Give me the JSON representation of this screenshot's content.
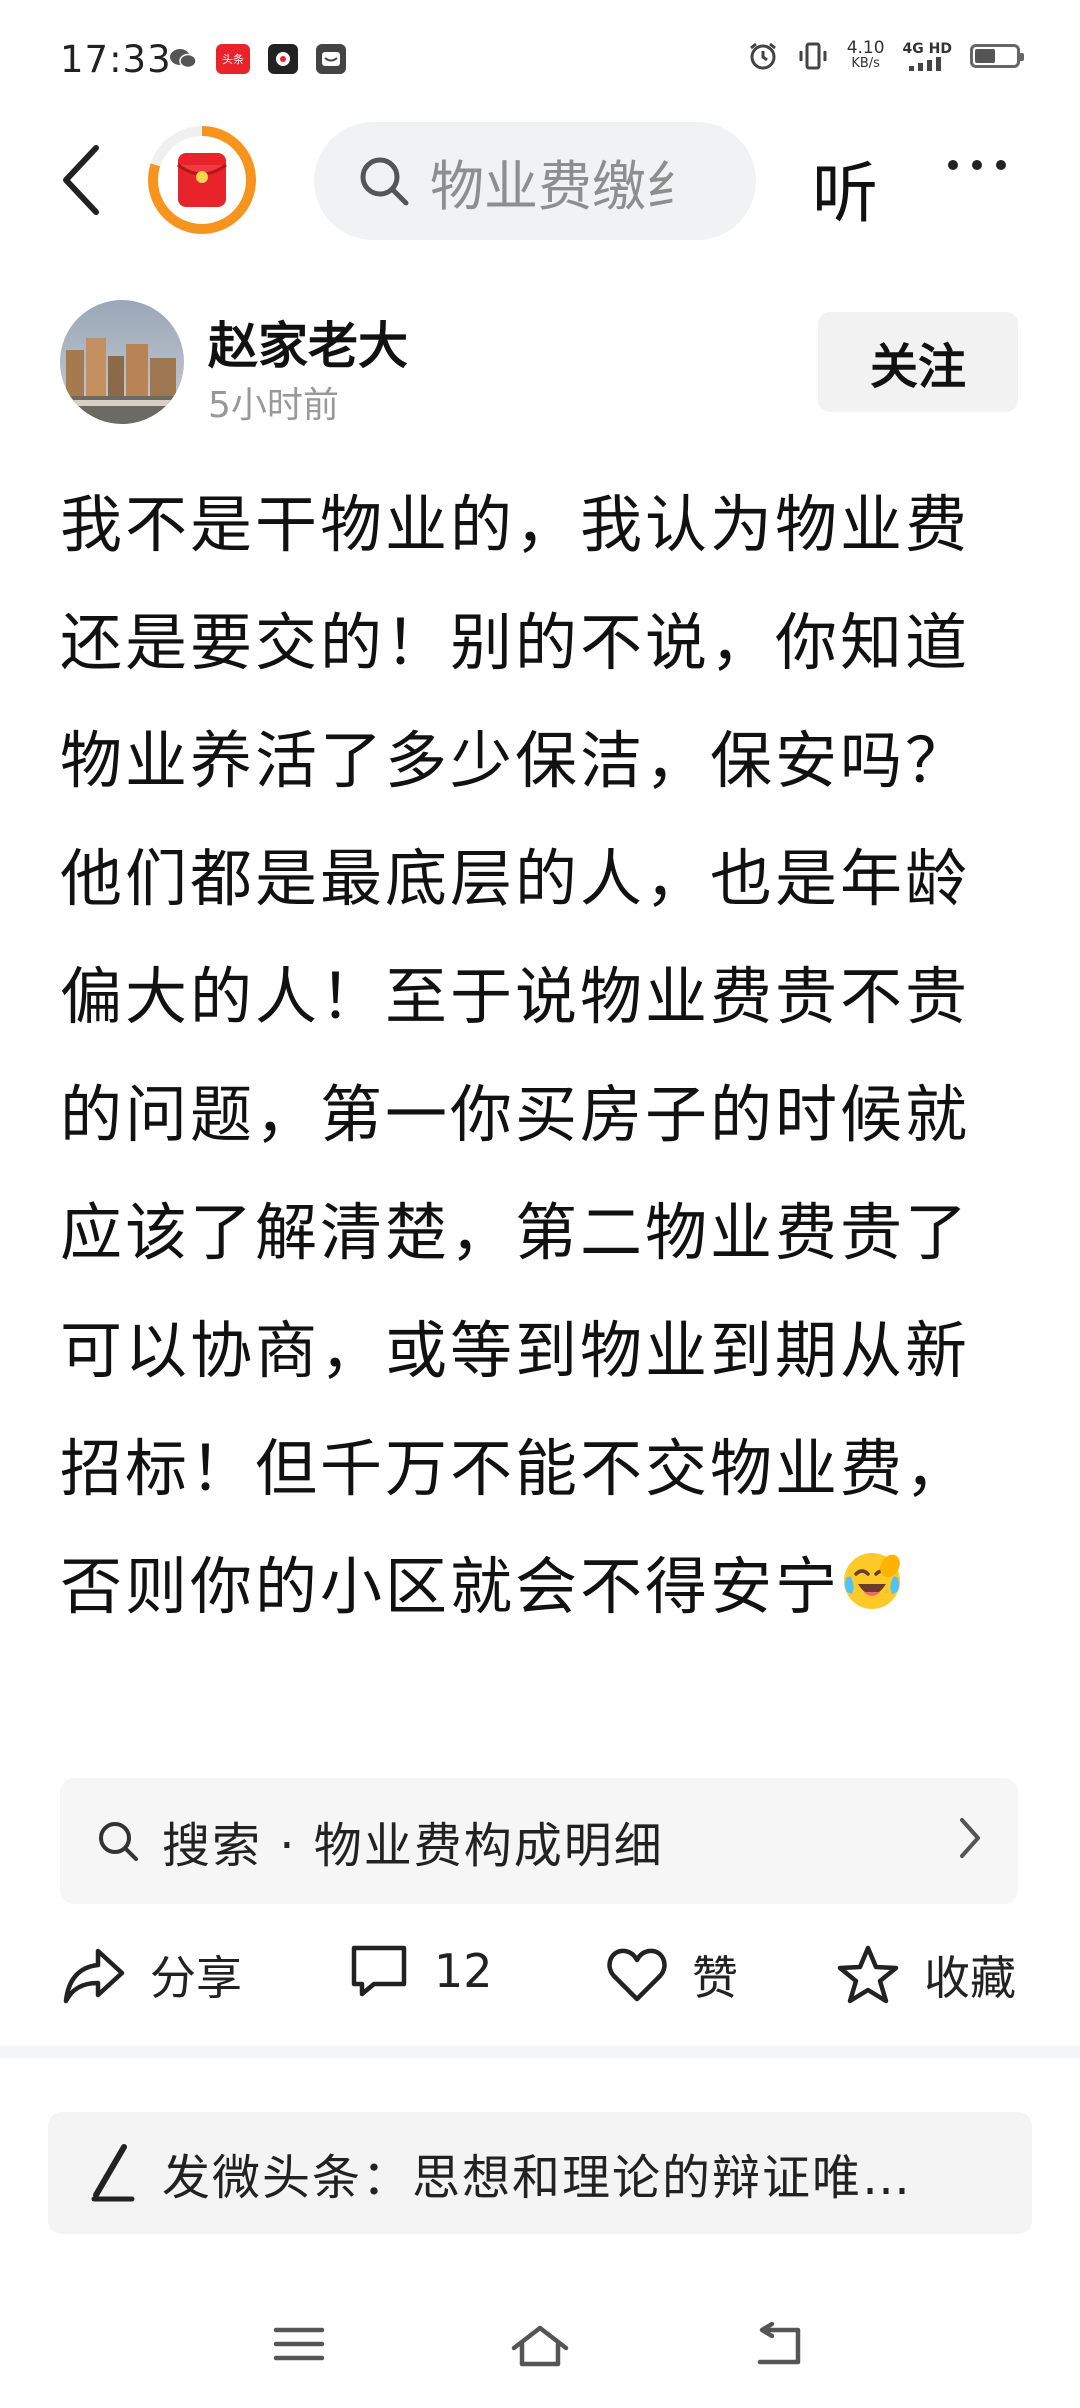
{
  "status_bar": {
    "time": "17:33",
    "app_icon_label": "头条",
    "net_speed_value": "4.10",
    "net_speed_unit": "KB/s",
    "net_type": "4G HD",
    "battery_level": 0.5
  },
  "top_nav": {
    "search_text": "物业费缴纟",
    "listen_label": "听"
  },
  "author": {
    "name": "赵家老大",
    "time": "5小时前",
    "follow_label": "关注"
  },
  "post": {
    "body": "我不是干物业的，我认为物业费还是要交的！别的不说，你知道物业养活了多少保洁，保安吗？他们都是最底层的人，也是年龄偏大的人！至于说物业费贵不贵的问题，第一你买房子的时候就应该了解清楚，第二物业费贵了可以协商，或等到物业到期从新招标！但千万不能不交物业费，否则你的小区就会不得安宁"
  },
  "suggestion": {
    "text": "搜索 · 物业费构成明细"
  },
  "actions": {
    "share_label": "分享",
    "comment_count": "12",
    "like_label": "赞",
    "favorite_label": "收藏"
  },
  "compose": {
    "text": "发微头条：思想和理论的辩证唯…"
  },
  "colors": {
    "accent_orange": "#f7941d",
    "red_packet": "#e8232b",
    "text_primary": "#111111",
    "text_secondary": "#999999",
    "pill_bg": "#f1f2f3"
  }
}
